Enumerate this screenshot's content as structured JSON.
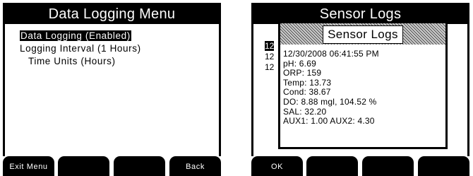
{
  "left_screen": {
    "title": "Data Logging Menu",
    "menu": [
      {
        "label": "Data Logging (Enabled)"
      },
      {
        "label": "Logging Interval (1 Hours)"
      },
      {
        "label": "Time Units (Hours)"
      }
    ],
    "softkeys": {
      "key1": "Exit Menu",
      "key2": "",
      "key3": "",
      "key4": "Back"
    }
  },
  "right_screen": {
    "title": "Sensor Logs",
    "list_behind": [
      "12",
      "12",
      "12"
    ],
    "popup": {
      "title": "Sensor Logs",
      "lines": [
        "12/30/2008  06:41:55 PM",
        "pH: 6.69",
        "ORP: 159",
        "Temp: 13.73",
        "Cond: 38.67",
        "DO: 8.88 mgl, 104.52 %",
        "SAL: 32.20",
        "AUX1: 1.00 AUX2: 4.30"
      ]
    },
    "softkeys": {
      "key1": "OK",
      "key2": "",
      "key3": "",
      "key4": ""
    }
  }
}
